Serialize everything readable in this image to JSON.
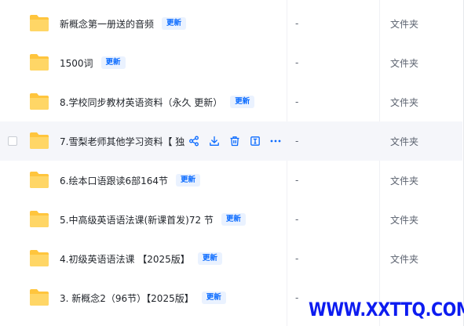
{
  "file_list": {
    "rows": [
      {
        "name": "新概念第一册送的音频",
        "badge": "更新",
        "size": "-",
        "type": "文件夹"
      },
      {
        "name": "1500词",
        "badge": "更新",
        "size": "-",
        "type": "文件夹"
      },
      {
        "name": "8.学校同步教材英语资料（永久 更新）",
        "badge": "更新",
        "size": "-",
        "type": "文件夹"
      },
      {
        "name": "7.雪梨老师其他学习资料【 独家",
        "badge": "",
        "size": "-",
        "type": "文件夹"
      },
      {
        "name": "6.绘本口语跟读6部164节",
        "badge": "更新",
        "size": "-",
        "type": "文件夹"
      },
      {
        "name": "5.中高级英语语法课(新课首发)72 节",
        "badge": "更新",
        "size": "-",
        "type": "文件夹"
      },
      {
        "name": "4.初级英语语法课 【2025版】",
        "badge": "更新",
        "size": "-",
        "type": "文件夹"
      },
      {
        "name": "3. 新概念2（96节）【2025版】",
        "badge": "更新",
        "size": "-",
        "type": "文件夹"
      }
    ],
    "hover_row_actions": [
      "share-icon",
      "download-icon",
      "delete-icon",
      "rename-icon",
      "more-icon"
    ]
  },
  "watermark": "WWW.XXTTQ.COM",
  "colors": {
    "folder": "#ffc53d",
    "badge_bg": "#eaf2ff",
    "badge_text": "#0b6bff",
    "action_icon": "#0b6bff",
    "watermark": "#0d1cf0",
    "hover_row": "#f5f6fa"
  }
}
